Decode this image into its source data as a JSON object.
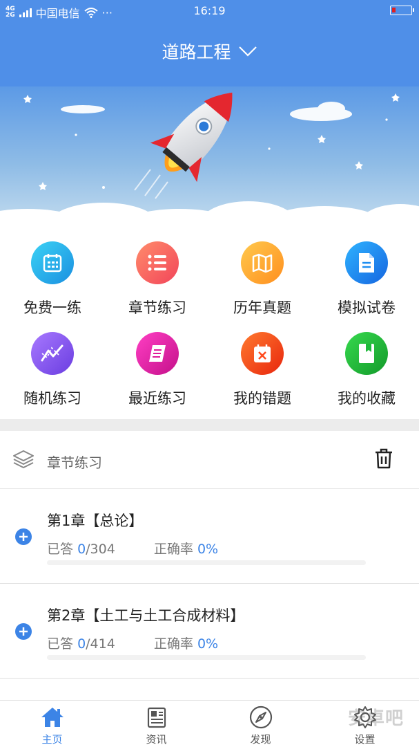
{
  "status_bar": {
    "network_top": "4G",
    "network_bottom": "2G",
    "carrier": "中国电信",
    "dots": "···",
    "time": "16:19"
  },
  "header": {
    "title": "道路工程",
    "bg_color": "#4f8fe8"
  },
  "quick_menu": [
    {
      "label": "免费一练",
      "icon": "calendar-icon",
      "color": "#1aa8e0"
    },
    {
      "label": "章节练习",
      "icon": "list-icon",
      "color": "#ff6a5a"
    },
    {
      "label": "历年真题",
      "icon": "map-icon",
      "color": "#ffb02e"
    },
    {
      "label": "模拟试卷",
      "icon": "document-icon",
      "color": "#1e8ef0"
    },
    {
      "label": "随机练习",
      "icon": "trend-icon",
      "color": "#8b5cf6"
    },
    {
      "label": "最近练习",
      "icon": "book-icon",
      "color": "#e0189a"
    },
    {
      "label": "我的错题",
      "icon": "error-calendar-icon",
      "color": "#ff4a1c"
    },
    {
      "label": "我的收藏",
      "icon": "bookmark-icon",
      "color": "#1fba3a"
    }
  ],
  "section": {
    "title": "章节练习",
    "icon": "stack-icon",
    "action_icon": "trash-icon"
  },
  "chapters": [
    {
      "title": "第1章【总论】",
      "answered_label": "已答",
      "answered": "0",
      "total": "/304",
      "rate_label": "正确率",
      "rate": "0%",
      "progress": 0
    },
    {
      "title": "第2章【土工与土工合成材料】",
      "answered_label": "已答",
      "answered": "0",
      "total": "/414",
      "rate_label": "正确率",
      "rate": "0%",
      "progress": 0
    }
  ],
  "tabs": [
    {
      "label": "主页",
      "icon": "home-icon",
      "active": true
    },
    {
      "label": "资讯",
      "icon": "news-icon",
      "active": false
    },
    {
      "label": "发现",
      "icon": "compass-icon",
      "active": false
    },
    {
      "label": "设置",
      "icon": "gear-icon",
      "active": false
    }
  ],
  "watermark": "安卓吧",
  "accent_color": "#3c84e6"
}
